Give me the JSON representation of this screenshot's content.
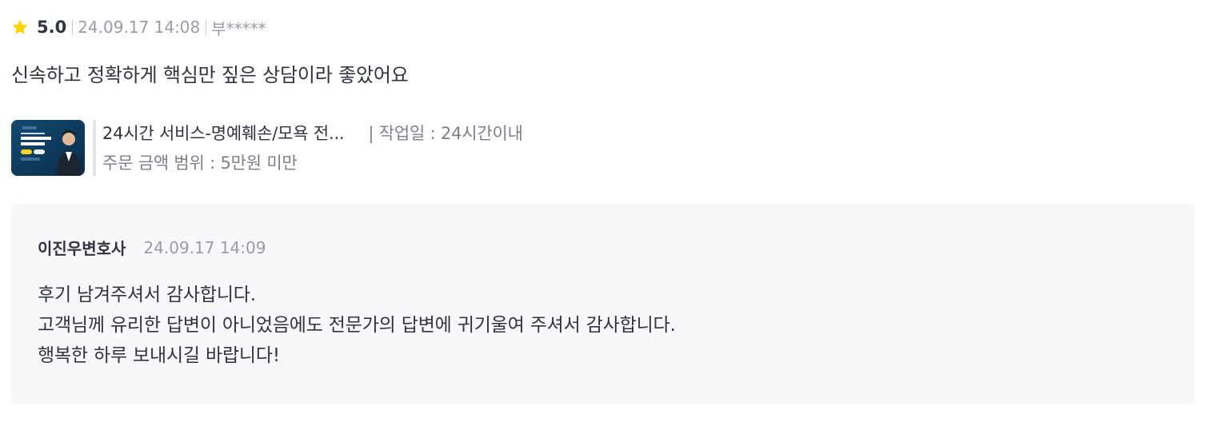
{
  "review": {
    "rating": "5.0",
    "date": "24.09.17 14:08",
    "author": "부*****",
    "text": "신속하고 정확하게 핵심만 짚은 상담이라 좋았어요",
    "star_color": "#ffd400"
  },
  "service": {
    "thumbnail_icon": "lawyer-promo-thumbnail",
    "title": "24시간 서비스-명예훼손/모욕 전...",
    "work_period": "| 작업일 : 24시간이내",
    "price_range": "주문 금액 범위 : 5만원 미만"
  },
  "reply": {
    "author": "이진우변호사",
    "date": "24.09.17 14:09",
    "lines": [
      "후기 남겨주셔서 감사합니다.",
      "고객님께 유리한 답변이 아니었음에도 전문가의 답변에 귀기울여 주셔서 감사합니다.",
      "행복한 하루 보내시길 바랍니다!"
    ]
  },
  "colors": {
    "text_primary": "#303441",
    "text_secondary": "#9a9ba7",
    "reply_background": "#f8f8fa",
    "thumbnail_background": "#0e3a5c"
  }
}
